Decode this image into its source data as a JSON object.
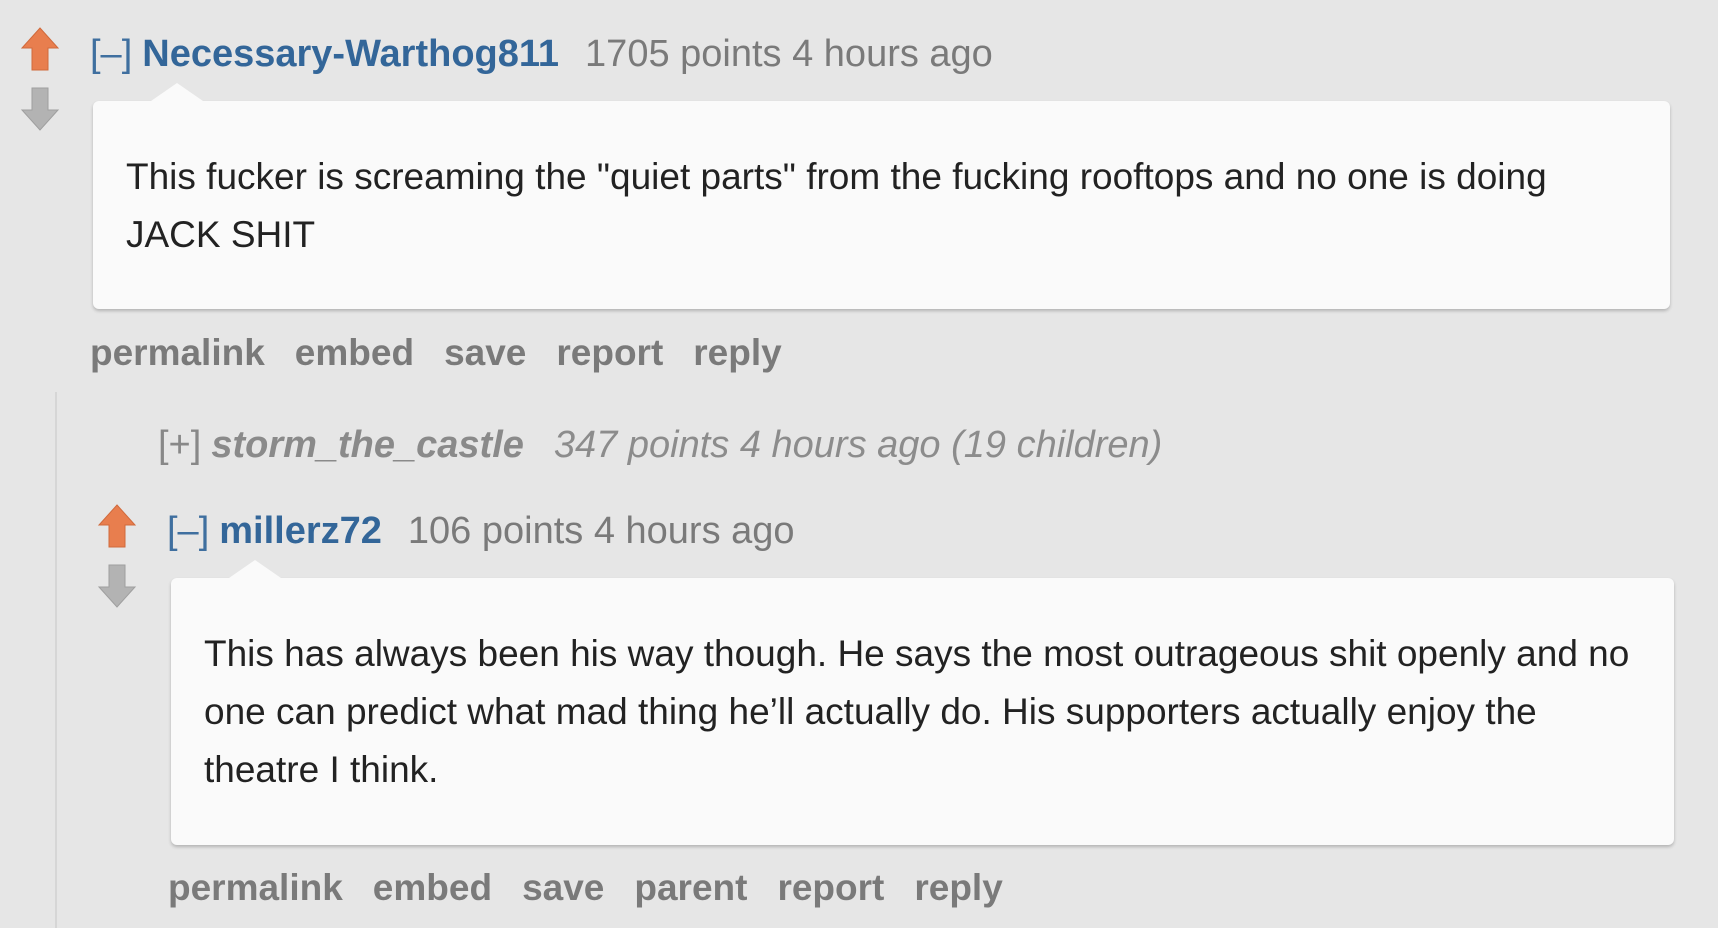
{
  "colors": {
    "background": "#e6e6e6",
    "author_link": "#336699",
    "upvote": "#e87e4e",
    "downvote": "#b3b3b3",
    "muted_text": "#888888"
  },
  "comments": [
    {
      "toggle": "[–]",
      "author": "Necessary-Warthog811",
      "score": "1705 points",
      "time": "4 hours ago",
      "body": "This fucker is screaming the \"quiet parts\" from the fucking rooftops and no one is doing JACK SHIT",
      "buttons": [
        "permalink",
        "embed",
        "save",
        "report",
        "reply"
      ]
    },
    {
      "toggle": "[+]",
      "author": "storm_the_castle",
      "score": "347 points",
      "time": "4 hours ago",
      "children": "(19 children)"
    },
    {
      "toggle": "[–]",
      "author": "millerz72",
      "score": "106 points",
      "time": "4 hours ago",
      "body": "This has always been his way though. He says the most outrageous shit openly and no one can predict what mad thing he’ll actually do. His supporters actually enjoy the theatre I think.",
      "buttons": [
        "permalink",
        "embed",
        "save",
        "parent",
        "report",
        "reply"
      ]
    }
  ],
  "icons": {
    "upvote": "upvote-arrow-icon",
    "downvote": "downvote-arrow-icon"
  }
}
